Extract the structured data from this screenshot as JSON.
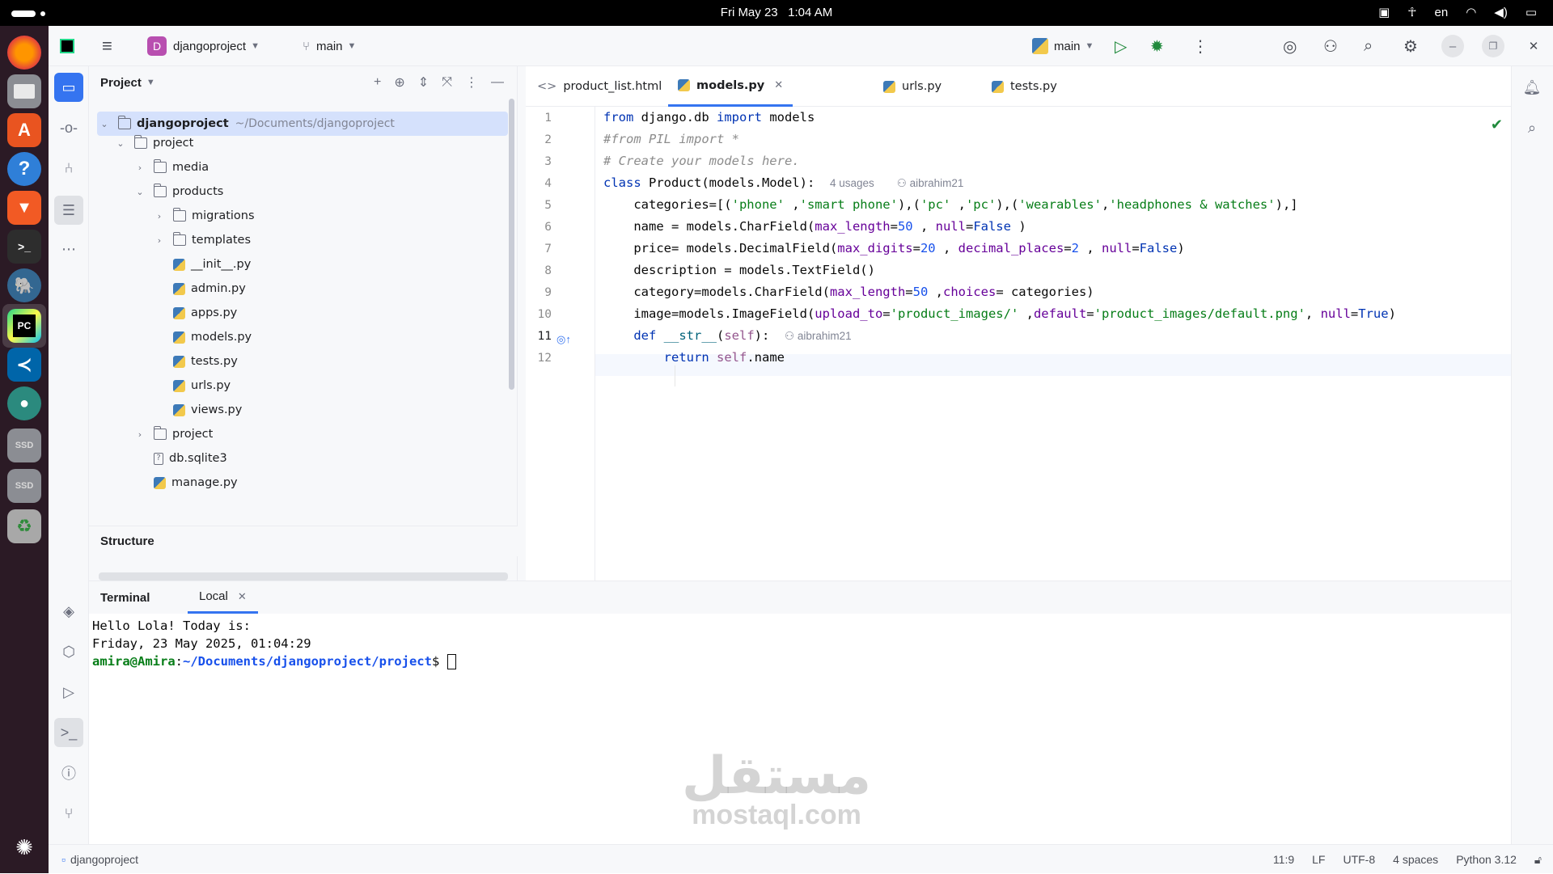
{
  "topbar": {
    "clock_date": "Fri May 23",
    "clock_time": "1:04 AM",
    "language": "en"
  },
  "dock": {
    "items": [
      "firefox-icon",
      "files-icon",
      "app-center-icon",
      "help-icon",
      "brave-icon",
      "terminal-icon",
      "postgres-icon",
      "pycharm-icon",
      "vscode-icon",
      "app-icon",
      "ssd-drive-icon",
      "ssd-drive-icon",
      "trash-icon",
      "show-apps-icon"
    ],
    "ssd_label": "SSD"
  },
  "header": {
    "project_badge": "D",
    "project_name": "djangoproject",
    "branch": "main",
    "run_config": "main"
  },
  "project_panel": {
    "title": "Project",
    "tree": [
      {
        "name": "djangoproject",
        "path": "~/Documents/djangoproject"
      },
      {
        "name": "project"
      },
      {
        "name": "media"
      },
      {
        "name": "products"
      },
      {
        "name": "migrations"
      },
      {
        "name": "templates"
      },
      {
        "name": "__init__.py"
      },
      {
        "name": "admin.py"
      },
      {
        "name": "apps.py"
      },
      {
        "name": "models.py"
      },
      {
        "name": "tests.py"
      },
      {
        "name": "urls.py"
      },
      {
        "name": "views.py"
      },
      {
        "name": "project"
      },
      {
        "name": "db.sqlite3"
      },
      {
        "name": "manage.py"
      }
    ]
  },
  "structure": {
    "title": "Structure"
  },
  "editor": {
    "tabs": [
      {
        "label": "product_list.html"
      },
      {
        "label": "models.py"
      },
      {
        "label": "urls.py"
      },
      {
        "label": "tests.py"
      }
    ],
    "line_numbers": [
      "1",
      "2",
      "3",
      "4",
      "5",
      "6",
      "7",
      "8",
      "9",
      "10",
      "11",
      "12"
    ],
    "hints": {
      "usages": "4 usages",
      "author_class": "aibrahim21",
      "author_def": "aibrahim21"
    }
  },
  "terminal": {
    "tab_title": "Terminal",
    "local_tab": "Local",
    "line1": "Hello Lola! Today is:",
    "line2": "Friday, 23 May 2025, 01:04:29",
    "prompt_user": "amira@Amira",
    "prompt_sep": ":",
    "prompt_path": "~/Documents/djangoproject/project",
    "prompt_end": "$ "
  },
  "statusbar": {
    "breadcrumb": "djangoproject",
    "position": "11:9",
    "line_sep": "LF",
    "encoding": "UTF-8",
    "indent": "4 spaces",
    "interpreter": "Python 3.12"
  },
  "watermark": {
    "arabic": "مستقل",
    "latin": "mostaql.com"
  },
  "colors": {
    "accent": "#3574f0",
    "keyword": "#0033b3",
    "string": "#067d17",
    "number": "#1750eb",
    "param": "#660099",
    "comment": "#8c8c8c"
  }
}
